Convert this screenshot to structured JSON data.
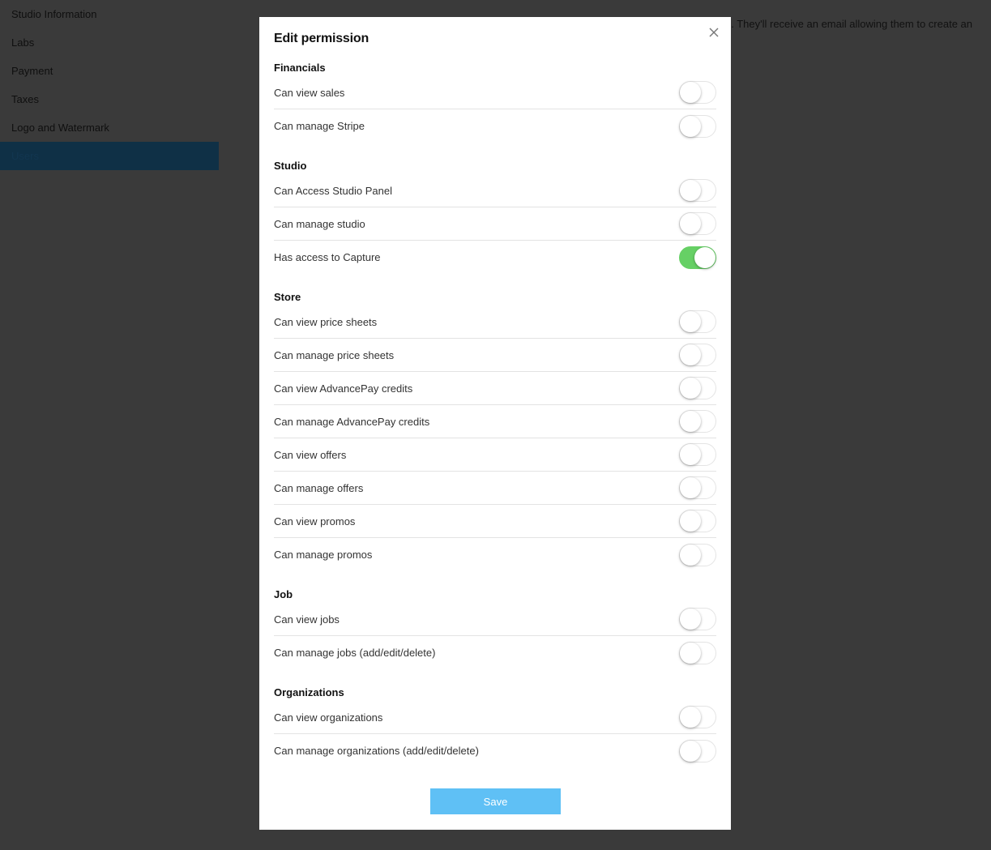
{
  "sidebar": {
    "items": [
      {
        "label": "Studio Information",
        "active": false
      },
      {
        "label": "Labs",
        "active": false
      },
      {
        "label": "Payment",
        "active": false
      },
      {
        "label": "Taxes",
        "active": false
      },
      {
        "label": "Logo and Watermark",
        "active": false
      },
      {
        "label": "Users",
        "active": true
      }
    ]
  },
  "background": {
    "description_text": "o. They'll receive an email allowing them to create an"
  },
  "modal": {
    "title": "Edit permission",
    "close_icon": "close-icon",
    "save_label": "Save",
    "sections": [
      {
        "title": "Financials",
        "permissions": [
          {
            "label": "Can view sales",
            "enabled": false
          },
          {
            "label": "Can manage Stripe",
            "enabled": false
          }
        ]
      },
      {
        "title": "Studio",
        "permissions": [
          {
            "label": "Can Access Studio Panel",
            "enabled": false
          },
          {
            "label": "Can manage studio",
            "enabled": false
          },
          {
            "label": "Has access to Capture",
            "enabled": true
          }
        ]
      },
      {
        "title": "Store",
        "permissions": [
          {
            "label": "Can view price sheets",
            "enabled": false
          },
          {
            "label": "Can manage price sheets",
            "enabled": false
          },
          {
            "label": "Can view AdvancePay credits",
            "enabled": false
          },
          {
            "label": "Can manage AdvancePay credits",
            "enabled": false
          },
          {
            "label": "Can view offers",
            "enabled": false
          },
          {
            "label": "Can manage offers",
            "enabled": false
          },
          {
            "label": "Can view promos",
            "enabled": false
          },
          {
            "label": "Can manage promos",
            "enabled": false
          }
        ]
      },
      {
        "title": "Job",
        "permissions": [
          {
            "label": "Can view jobs",
            "enabled": false
          },
          {
            "label": "Can manage jobs (add/edit/delete)",
            "enabled": false
          }
        ]
      },
      {
        "title": "Organizations",
        "permissions": [
          {
            "label": "Can view organizations",
            "enabled": false
          },
          {
            "label": "Can manage organizations (add/edit/delete)",
            "enabled": false
          }
        ]
      }
    ]
  },
  "colors": {
    "toggle_on": "#66d065",
    "save_button": "#5fc0f5",
    "active_sidebar": "#0f3046",
    "overlay": "#3a3a3a"
  }
}
